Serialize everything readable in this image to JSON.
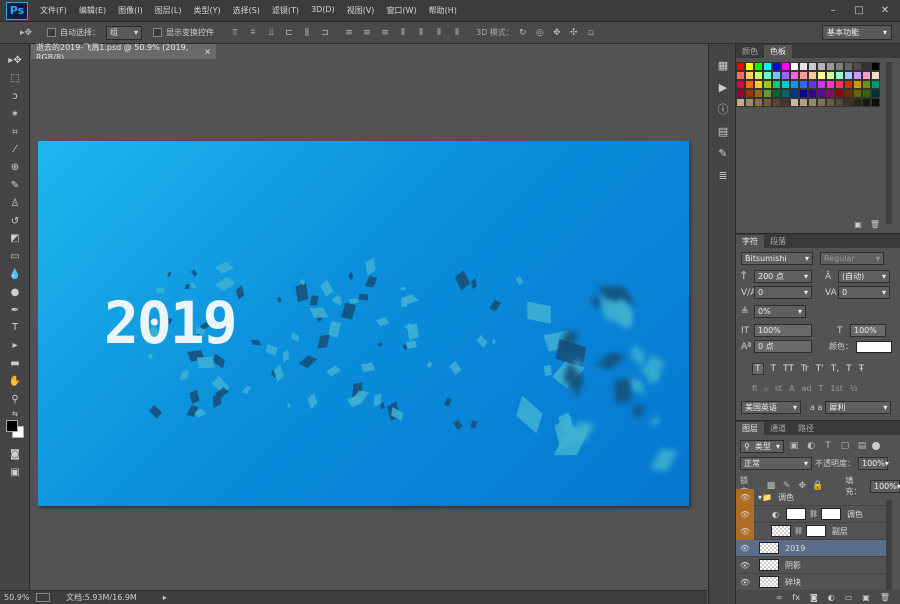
{
  "app": {
    "logo": "Ps"
  },
  "menu": [
    "文件(F)",
    "编辑(E)",
    "图像(I)",
    "图层(L)",
    "类型(Y)",
    "选择(S)",
    "滤镜(T)",
    "3D(D)",
    "视图(V)",
    "窗口(W)",
    "帮助(H)"
  ],
  "options": {
    "auto_select_label": "自动选择：",
    "auto_select_value": "组",
    "show_transform_label": "显示变换控件",
    "mode_3d_label": "3D 模式：",
    "workspace": "基本功能"
  },
  "document": {
    "tab_title": "逝去的2019-飞溅1.psd @ 50.9% (2019, RGB/8)",
    "close": "×",
    "canvas_text": "2019"
  },
  "status": {
    "zoom": "50.9%",
    "doc_info": "文档:5.93M/16.9M"
  },
  "panels": {
    "color_tabs": [
      "颜色",
      "色板"
    ],
    "char_tabs": [
      "字符",
      "段落"
    ],
    "font_family": "Bitsumishi",
    "font_style": "Regular",
    "font_size": "200 点",
    "leading": "(自动)",
    "kerning": "0",
    "tracking": "0",
    "baseline": "0%",
    "vscale": "100%",
    "hscale": "100%",
    "shift": "0 点",
    "color_label": "颜色：",
    "type_buttons": [
      "T",
      "T",
      "TT",
      "Tr",
      "T'",
      "T,",
      "T",
      "Ŧ"
    ],
    "ot_buttons": [
      "fi",
      "ℴ",
      "st",
      "A",
      "ad",
      "T",
      "1st",
      "½"
    ],
    "language": "美国英语",
    "aa_label": "a a",
    "aa_value": "犀利",
    "layer_tabs": [
      "图层",
      "通道",
      "路径"
    ],
    "filter_kind": "类型",
    "blend_mode": "正常",
    "opacity_label": "不透明度：",
    "opacity": "100%",
    "lock_label": "锁定：",
    "fill_label": "填充：",
    "fill": "100%",
    "layers": [
      {
        "name": "调色",
        "type": "group"
      },
      {
        "name": "调色",
        "type": "adjust"
      },
      {
        "name": "副层",
        "type": "masked"
      },
      {
        "name": "2019",
        "type": "selected"
      },
      {
        "name": "阴影",
        "type": "normal"
      },
      {
        "name": "碎块",
        "type": "normal"
      }
    ]
  },
  "colors": {
    "accent": "#31a8ff",
    "selected_layer": "#5a6d8a",
    "eye_group": "#b06c22"
  }
}
